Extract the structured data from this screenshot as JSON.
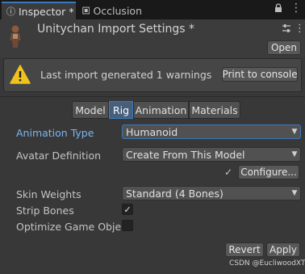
{
  "tabs": [
    {
      "label": "Inspector",
      "icon": "info-icon",
      "modified": "*"
    },
    {
      "label": "Occlusion",
      "icon": "occlusion-icon"
    }
  ],
  "header": {
    "title": "Unitychan Import Settings *",
    "open_label": "Open",
    "asset_icon": "character-model-icon"
  },
  "warning": {
    "text": "Last import generated 1 warnings",
    "button_label": "Print to console",
    "icon": "warning-icon",
    "icon_color": "#f0c21e"
  },
  "toolbar": {
    "tabs": [
      "Model",
      "Rig",
      "Animation",
      "Materials"
    ],
    "selected": "Rig",
    "accent": "#3a79bb"
  },
  "form": {
    "animation_type": {
      "label": "Animation Type",
      "value": "Humanoid"
    },
    "avatar_definition": {
      "label": "Avatar Definition",
      "value": "Create From This Model"
    },
    "configure_label": "Configure...",
    "check_glyph": "✓",
    "skin_weights": {
      "label": "Skin Weights",
      "value": "Standard (4 Bones)"
    },
    "strip_bones": {
      "label": "Strip Bones",
      "checked": true,
      "glyph": "✓"
    },
    "optimize": {
      "label": "Optimize Game Objects",
      "checked": false
    }
  },
  "actions": {
    "revert_label": "Revert",
    "apply_label": "Apply"
  },
  "watermark": "CSDN @EucliwoodXT"
}
